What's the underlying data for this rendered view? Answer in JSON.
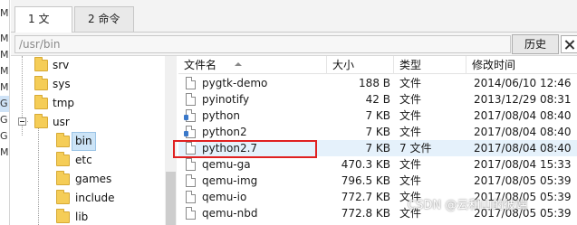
{
  "gutter": [
    "M",
    "M",
    "M",
    "M",
    "M",
    "G",
    "G",
    "G",
    "M"
  ],
  "tabs": [
    {
      "label": "1 文件",
      "active": true
    },
    {
      "label": "2 命令",
      "active": false
    }
  ],
  "pathbar": {
    "path": "/usr/bin",
    "history_label": "历史"
  },
  "tree": [
    {
      "label": "srv"
    },
    {
      "label": "sys"
    },
    {
      "label": "tmp"
    },
    {
      "label": "usr"
    },
    {
      "label": "bin",
      "selected": true
    },
    {
      "label": "etc"
    },
    {
      "label": "games"
    },
    {
      "label": "include"
    },
    {
      "label": "lib"
    }
  ],
  "columns": {
    "name": "文件名",
    "size": "大小",
    "type": "类型",
    "modified": "修改时间"
  },
  "files": [
    {
      "name": "pygtk-demo",
      "size": "188 B",
      "type": "文件",
      "modified": "2014/06/10 12:46",
      "icon": "file-icon"
    },
    {
      "name": "pyinotify",
      "size": "42 B",
      "type": "文件",
      "modified": "2013/12/29 08:31",
      "icon": "file-icon"
    },
    {
      "name": "python",
      "size": "7 KB",
      "type": "文件",
      "modified": "2017/08/04 08:40",
      "icon": "python-file-icon"
    },
    {
      "name": "python2",
      "size": "7 KB",
      "type": "文件",
      "modified": "2017/08/04 08:40",
      "icon": "python-file-icon"
    },
    {
      "name": "python2.7",
      "size": "7 KB",
      "type": "7 文件",
      "modified": "2017/08/04 08:40",
      "icon": "file-icon",
      "highlighted": true
    },
    {
      "name": "qemu-ga",
      "size": "470.3 KB",
      "type": "文件",
      "modified": "2017/08/04 15:33",
      "icon": "file-icon"
    },
    {
      "name": "qemu-img",
      "size": "796.5 KB",
      "type": "文件",
      "modified": "2017/08/05 05:39",
      "icon": "file-icon"
    },
    {
      "name": "qemu-io",
      "size": "772.7 KB",
      "type": "文件",
      "modified": "2017/08/05 05:39",
      "icon": "file-icon"
    },
    {
      "name": "qemu-nbd",
      "size": "772.8 KB",
      "type": "文件",
      "modified": "2017/08/05 05:39",
      "icon": "file-icon"
    }
  ],
  "watermark": "CSDN @云和山的彼端",
  "colors": {
    "selection": "#cce4f7",
    "hover_row": "#e5f1fb",
    "red_mark": "#e02020",
    "folder": "#f5cd57"
  }
}
